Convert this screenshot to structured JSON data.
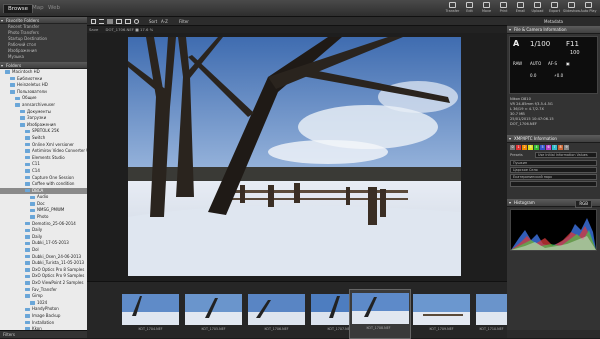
{
  "mode_tabs": [
    "Browse",
    "Map",
    "Web"
  ],
  "toolbar": [
    {
      "label": "Transfer",
      "icon": "transfer-icon"
    },
    {
      "label": "Edit",
      "icon": "edit-icon"
    },
    {
      "label": "Move",
      "icon": "move-icon"
    },
    {
      "label": "Print",
      "icon": "print-icon"
    },
    {
      "label": "Email",
      "icon": "email-icon"
    },
    {
      "label": "Upload",
      "icon": "upload-icon"
    },
    {
      "label": "Export",
      "icon": "export-icon"
    },
    {
      "label": "Slideshow",
      "icon": "slideshow-icon"
    },
    {
      "label": "Auto Play",
      "icon": "auto-play-icon"
    }
  ],
  "left_panel": {
    "favorites_header": "Favorite Folders",
    "favorites": [
      "Recent Transfer",
      "Photo Transfers",
      "Startup Destination",
      "Рабочий стол",
      "Изображения",
      "Музыка"
    ],
    "folders_header": "Folders",
    "tree": [
      {
        "label": "Macintosh HD",
        "indent": 1
      },
      {
        "label": "Библиотеки",
        "indent": 2
      },
      {
        "label": "Heinzeletus HD",
        "indent": 2
      },
      {
        "label": "Пользователи",
        "indent": 2
      },
      {
        "label": "Общие",
        "indent": 3
      },
      {
        "label": "annsarchiveuser",
        "indent": 3
      },
      {
        "label": "Документы",
        "indent": 4
      },
      {
        "label": "Загрузки",
        "indent": 4
      },
      {
        "label": "Изображения",
        "indent": 4
      },
      {
        "label": "SPBTOLK 25K",
        "indent": 5
      },
      {
        "label": "Switch",
        "indent": 5
      },
      {
        "label": "Online Xml versioner",
        "indent": 5
      },
      {
        "label": "Antimirov Video Converter Ultimate",
        "indent": 5
      },
      {
        "label": "Elements Studio",
        "indent": 5
      },
      {
        "label": "C11",
        "indent": 5
      },
      {
        "label": "C14",
        "indent": 5
      },
      {
        "label": "Capture One Session",
        "indent": 5
      },
      {
        "label": "Coffee with condition",
        "indent": 5
      },
      {
        "label": "DBCA",
        "indent": 5,
        "selected": true
      },
      {
        "label": "Audio",
        "indent": 6
      },
      {
        "label": "Doc",
        "indent": 6
      },
      {
        "label": "NMSG_PMWM",
        "indent": 6
      },
      {
        "label": "Photo",
        "indent": 6
      },
      {
        "label": "Demotiro_25-06-2014",
        "indent": 5
      },
      {
        "label": "Daily",
        "indent": 5
      },
      {
        "label": "Daily",
        "indent": 5
      },
      {
        "label": "Dubki_17-05-2013",
        "indent": 5
      },
      {
        "label": "Dol",
        "indent": 5
      },
      {
        "label": "Dubki_Osen_24-06-2013",
        "indent": 5
      },
      {
        "label": "Dubki_Turista_11-05-2013",
        "indent": 5
      },
      {
        "label": "DxO Optics Pro 8 Samples",
        "indent": 5
      },
      {
        "label": "DxO Optics Pro 9 Samples",
        "indent": 5
      },
      {
        "label": "DxO ViewPoint 2 Samples",
        "indent": 5
      },
      {
        "label": "Fav_Transfer",
        "indent": 5
      },
      {
        "label": "Gimp",
        "indent": 5
      },
      {
        "label": "1024",
        "indent": 6
      },
      {
        "label": "HandyPhoton",
        "indent": 5
      },
      {
        "label": "Image Backup",
        "indent": 5
      },
      {
        "label": "Installation",
        "indent": 5
      },
      {
        "label": "Kkon",
        "indent": 5
      },
      {
        "label": "Lite",
        "indent": 5
      }
    ],
    "footer": "Filters"
  },
  "center": {
    "grid_icon": "grid-view-icon",
    "sort_label": "Sort",
    "sort_value": "A-Z",
    "filter_label": "Filter",
    "file_info": "DOT_1706.NEF  ■  17.6 %",
    "scene_label": "Save"
  },
  "filmstrip": [
    {
      "name": "KOT_1704.NEF"
    },
    {
      "name": "KOT_1705.NEF"
    },
    {
      "name": "KOT_1706.NEF"
    },
    {
      "name": "KOT_1707.NEF"
    },
    {
      "name": "KOT_1708.NEF",
      "selected": true
    },
    {
      "name": "KOT_1709.NEF"
    },
    {
      "name": "KOT_1710.NEF"
    }
  ],
  "right_panel": {
    "top_label": "Metadata",
    "camera_header": "File & Camera Information",
    "camera": {
      "mode": "A",
      "shutter": "1/100",
      "aperture": "F11",
      "iso": "100",
      "quality": "RAW",
      "wb": "AUTO",
      "af": "AF-S",
      "metering": "▣",
      "exposure": "0.0",
      "flash": "⚡0.0"
    },
    "info_lines": [
      "Nikon D810",
      "VR 24-85mm f/3.5-4.5G",
      "L 36/19 ≈ 4.7/2.7X",
      "30.7 MB",
      "25/01/2015 10:47:06.15",
      "DOT_1706.NEF"
    ],
    "xmp_header": "XMP/IPTC Information",
    "labels": [
      "0",
      "1",
      "2",
      "3",
      "4",
      "5",
      "6",
      "7",
      "8",
      "9"
    ],
    "label_colors": [
      "#777",
      "#d33",
      "#e80",
      "#dd2",
      "#3b3",
      "#35c",
      "#b4c",
      "#3bc",
      "#c63",
      "#888"
    ],
    "preset_label": "Presets",
    "preset_value": "Use Initial Information Values",
    "fields": [
      "Пушкин",
      "Царское Село",
      "Екатерининский парк",
      ""
    ],
    "histogram_header": "Histogram",
    "histogram_mode": "RGB"
  }
}
